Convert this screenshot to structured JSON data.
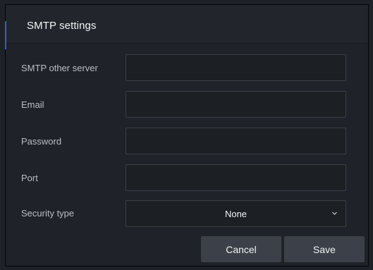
{
  "dialog": {
    "title": "SMTP settings"
  },
  "form": {
    "fields": [
      {
        "label": "SMTP other server",
        "value": ""
      },
      {
        "label": "Email",
        "value": ""
      },
      {
        "label": "Password",
        "value": ""
      },
      {
        "label": "Port",
        "value": ""
      }
    ],
    "security": {
      "label": "Security type",
      "selected": "None",
      "icon": "chevron-down-icon"
    }
  },
  "buttons": {
    "cancel_label": "Cancel",
    "save_label": "Save"
  },
  "colors": {
    "background": "#1f2228",
    "field_border": "#3a3f47",
    "button": "#3c4048",
    "accent": "#2e5fd6"
  }
}
